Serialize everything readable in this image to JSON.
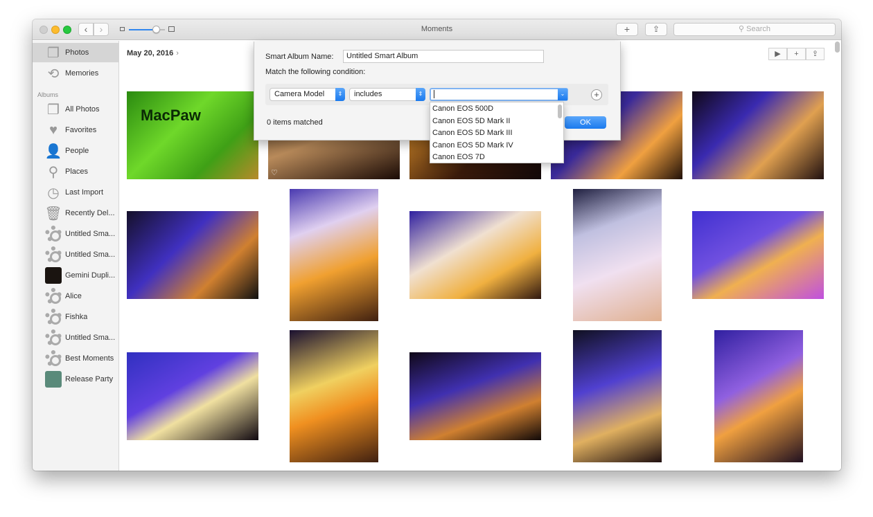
{
  "window": {
    "title": "Moments"
  },
  "toolbar": {
    "back_icon": "‹",
    "forward_icon": "›",
    "zoom_level": 0.75,
    "add_label": "+",
    "share_icon": "⇪",
    "search_placeholder": "Search"
  },
  "sidebar": {
    "top_items": [
      {
        "label": "Photos",
        "icon": "photos-icon",
        "selected": true
      },
      {
        "label": "Memories",
        "icon": "memories-icon"
      }
    ],
    "albums_header": "Albums",
    "albums": [
      {
        "label": "All Photos",
        "icon": "all-photos-icon"
      },
      {
        "label": "Favorites",
        "icon": "heart-icon"
      },
      {
        "label": "People",
        "icon": "person-icon"
      },
      {
        "label": "Places",
        "icon": "pin-icon"
      },
      {
        "label": "Last Import",
        "icon": "clock-icon"
      },
      {
        "label": "Recently Del...",
        "icon": "trash-icon"
      },
      {
        "label": "Untitled Sma...",
        "icon": "gear-icon"
      },
      {
        "label": "Untitled Sma...",
        "icon": "gear-icon"
      },
      {
        "label": "Gemini Dupli...",
        "icon": "thumbnail",
        "color": "#1a1410"
      },
      {
        "label": "Alice",
        "icon": "gear-icon"
      },
      {
        "label": "Fishka",
        "icon": "gear-icon"
      },
      {
        "label": "Untitled Sma...",
        "icon": "gear-icon"
      },
      {
        "label": "Best Moments",
        "icon": "gear-icon"
      },
      {
        "label": "Release Party",
        "icon": "thumbnail",
        "color": "#5a8a7a"
      }
    ]
  },
  "main": {
    "date": "May 20, 2016",
    "date_chevron": "›",
    "tools": {
      "play": "▶",
      "add": "+",
      "share": "⇪"
    }
  },
  "dialog": {
    "name_label": "Smart Album Name:",
    "name_value": "Untitled Smart Album",
    "match_label": "Match the following condition:",
    "field": "Camera Model",
    "operator": "includes",
    "value": "",
    "add_condition": "+",
    "matched": "0 items matched",
    "ok": "OK",
    "options": [
      "Canon EOS 500D",
      "Canon EOS 5D Mark II",
      "Canon EOS 5D Mark III",
      "Canon EOS 5D Mark IV",
      "Canon EOS 7D"
    ]
  },
  "photos": [
    {
      "bg": "linear-gradient(135deg,#2a8a10,#6fd82a 40%,#3fa016 70%,#b88a2a)",
      "label": "MacPaw",
      "favorite": false
    },
    {
      "bg": "linear-gradient(160deg,#3a2a1a,#b88a5a 50%,#1a0a05)",
      "favorite": true
    },
    {
      "bg": "linear-gradient(135deg,#f0a030,#3a1a0a 60%,#120808)"
    },
    {
      "bg": "linear-gradient(135deg,#1a1030,#3a2a9a 40%,#f0a040 70%,#201008)"
    },
    {
      "bg": "linear-gradient(135deg,#100818,#3a2ab0 35%,#e0a050 65%,#201010)"
    },
    {
      "bg": "linear-gradient(135deg,#15102a,#4030c0 40%,#d08030 70%,#101010)"
    },
    {
      "bg": "linear-gradient(160deg,#4a3ab0,#e0d0f0 30%,#f0a030 60%,#402010)"
    },
    {
      "bg": "linear-gradient(150deg,#3020a0,#f0e0d0 40%,#f0b040 70%,#301810)"
    },
    {
      "bg": "linear-gradient(160deg,#202040,#c0c0e0 30%,#f0e0f0 60%,#e0b090)"
    },
    {
      "bg": "linear-gradient(150deg,#4030d0,#7050e0 40%,#f0b050 60%,#c050e0)"
    },
    {
      "bg": "linear-gradient(150deg,#3030c0,#6040e0 40%,#f0e0a0 60%,#100810)"
    },
    {
      "bg": "linear-gradient(160deg,#1a1030,#f0d060 40%,#f09020 60%,#402010)"
    },
    {
      "bg": "linear-gradient(160deg,#100818,#4030b0 40%,#d08030 70%,#100808)"
    },
    {
      "bg": "linear-gradient(160deg,#101020,#5040d0 40%,#e0b060 70%,#201010)"
    },
    {
      "bg": "linear-gradient(150deg,#3020a0,#9060e0 40%,#f0a040 60%,#201020)"
    },
    {
      "bg": "linear-gradient(150deg,#e08020,#3020a0 50%,#100810)"
    },
    {
      "bg": "linear-gradient(150deg,#3030a0,#f0e0d0 40%,#f0a030 70%)"
    },
    {
      "bg": "linear-gradient(150deg,#100810,#3020a0 40%,#e0d0a0 70%,#100810)"
    },
    {
      "bg": "linear-gradient(150deg,#100818,#3a2ab0 50%,#101010)"
    },
    {
      "bg": "linear-gradient(90deg,#20a010 40%,#101010 60%,#f0c060)"
    }
  ]
}
